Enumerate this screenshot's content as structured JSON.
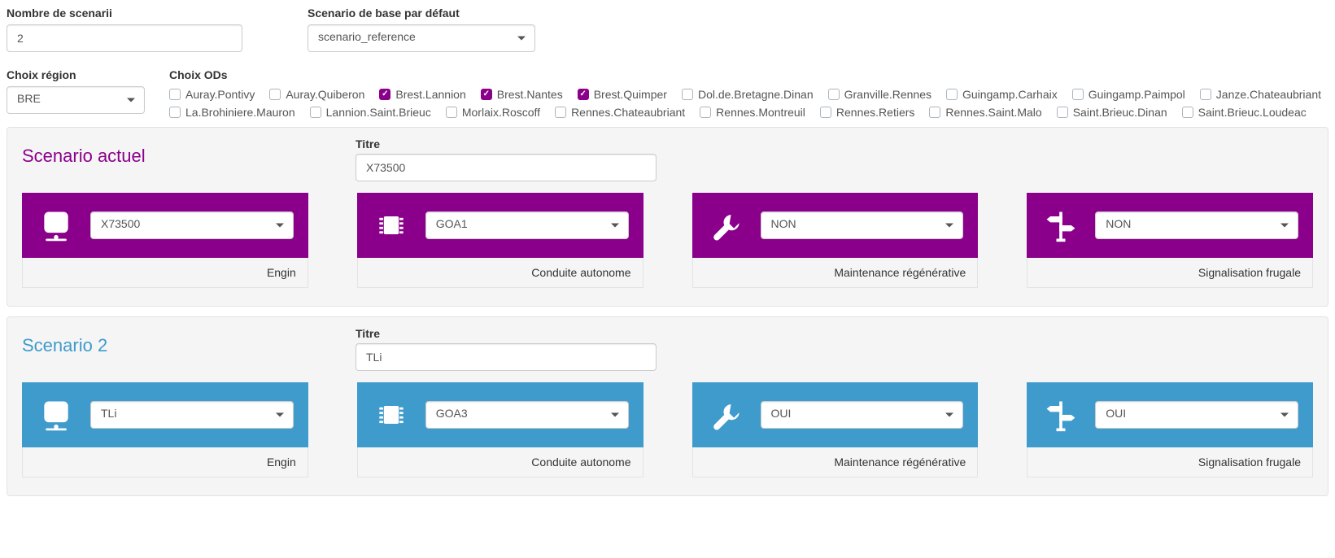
{
  "top": {
    "nombre_label": "Nombre de scenarii",
    "nombre_value": "2",
    "default_label": "Scenario de base par défaut",
    "default_value": "scenario_reference"
  },
  "region": {
    "label": "Choix région",
    "value": "BRE"
  },
  "ods": {
    "label": "Choix ODs",
    "items": [
      {
        "label": "Auray.Pontivy",
        "checked": false
      },
      {
        "label": "Auray.Quiberon",
        "checked": false
      },
      {
        "label": "Brest.Lannion",
        "checked": true
      },
      {
        "label": "Brest.Nantes",
        "checked": true
      },
      {
        "label": "Brest.Quimper",
        "checked": true
      },
      {
        "label": "Dol.de.Bretagne.Dinan",
        "checked": false
      },
      {
        "label": "Granville.Rennes",
        "checked": false
      },
      {
        "label": "Guingamp.Carhaix",
        "checked": false
      },
      {
        "label": "Guingamp.Paimpol",
        "checked": false
      },
      {
        "label": "Janze.Chateaubriant",
        "checked": false
      },
      {
        "label": "La.Brohiniere.Mauron",
        "checked": false
      },
      {
        "label": "Lannion.Saint.Brieuc",
        "checked": false
      },
      {
        "label": "Morlaix.Roscoff",
        "checked": false
      },
      {
        "label": "Rennes.Chateaubriant",
        "checked": false
      },
      {
        "label": "Rennes.Montreuil",
        "checked": false
      },
      {
        "label": "Rennes.Retiers",
        "checked": false
      },
      {
        "label": "Rennes.Saint.Malo",
        "checked": false
      },
      {
        "label": "Saint.Brieuc.Dinan",
        "checked": false
      },
      {
        "label": "Saint.Brieuc.Loudeac",
        "checked": false
      }
    ]
  },
  "scenarios": [
    {
      "title": "Scenario actuel",
      "color": "purple",
      "titre_label": "Titre",
      "titre_value": "X73500",
      "cards": [
        {
          "icon": "train",
          "value": "X73500",
          "footer": "Engin"
        },
        {
          "icon": "chip",
          "value": "GOA1",
          "footer": "Conduite autonome"
        },
        {
          "icon": "wrench",
          "value": "NON",
          "footer": "Maintenance régénérative"
        },
        {
          "icon": "signpost",
          "value": "NON",
          "footer": "Signalisation frugale"
        }
      ]
    },
    {
      "title": "Scenario 2",
      "color": "blue",
      "titre_label": "Titre",
      "titre_value": "TLi",
      "cards": [
        {
          "icon": "train",
          "value": "TLi",
          "footer": "Engin"
        },
        {
          "icon": "chip",
          "value": "GOA3",
          "footer": "Conduite autonome"
        },
        {
          "icon": "wrench",
          "value": "OUI",
          "footer": "Maintenance régénérative"
        },
        {
          "icon": "signpost",
          "value": "OUI",
          "footer": "Signalisation frugale"
        }
      ]
    }
  ]
}
